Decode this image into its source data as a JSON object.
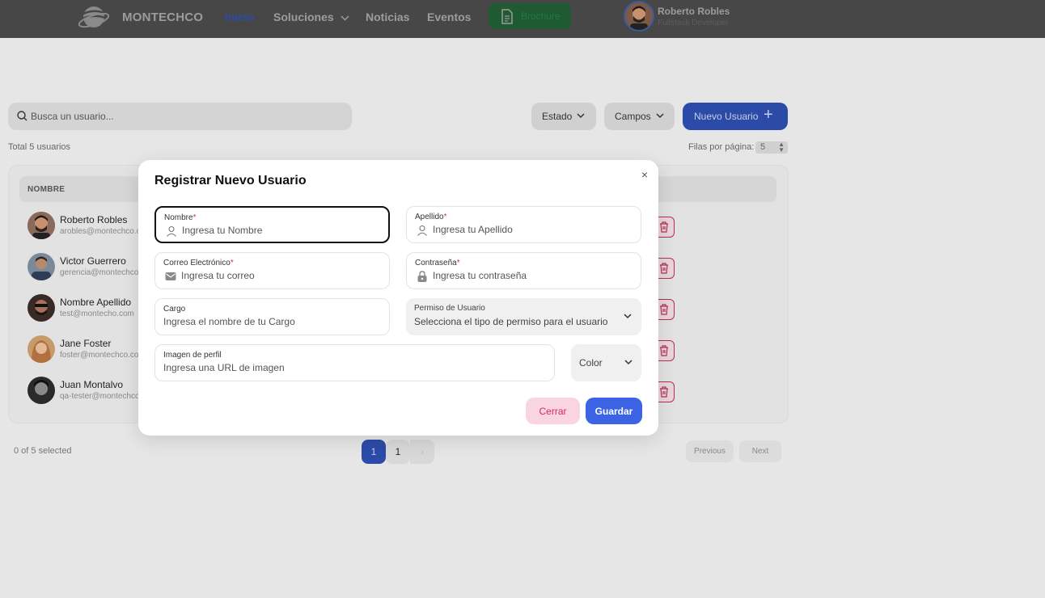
{
  "navbar": {
    "brand": "MONTECHCO",
    "links": {
      "inicio": "Inicio",
      "soluciones": "Soluciones",
      "noticias": "Noticias",
      "eventos": "Eventos"
    },
    "brochure_label": "Brochure",
    "user": {
      "name": "Roberto Robles",
      "role": "Fullstack Developer"
    }
  },
  "toolbar": {
    "search_placeholder": "Busca un usuario...",
    "estado_label": "Estado",
    "campos_label": "Campos",
    "new_user_label": "Nuevo Usuario"
  },
  "table": {
    "total_label": "Total 5 usuarios",
    "rows_per_page_label": "Filas por página:",
    "rows_per_page_value": "5",
    "column_nombre": "NOMBRE",
    "rows": [
      {
        "name": "Roberto Robles",
        "email": "arobles@montechco.co"
      },
      {
        "name": "Victor Guerrero",
        "email": "gerencia@montechco.co"
      },
      {
        "name": "Nombre Apellido",
        "email": "test@montecho.com"
      },
      {
        "name": "Jane Foster",
        "email": "foster@montechco.co"
      },
      {
        "name": "Juan Montalvo",
        "email": "qa-tester@montechco.co"
      }
    ]
  },
  "pagination": {
    "selected_label": "0 of 5 selected",
    "current_page": "1",
    "page_label": "1",
    "next_arrow": "›",
    "previous_label": "Previous",
    "next_label": "Next"
  },
  "modal": {
    "title": "Registrar Nuevo Usuario",
    "close_glyph": "×",
    "fields": {
      "nombre": {
        "label": "Nombre",
        "placeholder": "Ingresa tu Nombre"
      },
      "apellido": {
        "label": "Apellido",
        "placeholder": "Ingresa tu Apellido"
      },
      "correo": {
        "label": "Correo Electrónico",
        "placeholder": "Ingresa tu correo"
      },
      "contrasena": {
        "label": "Contraseña",
        "placeholder": "Ingresa tu contraseña"
      },
      "cargo": {
        "label": "Cargo",
        "placeholder": "Ingresa el nombre de tu Cargo"
      },
      "permiso": {
        "label": "Permiso de Usuario",
        "value": "Selecciona el tipo de permiso para el usuario"
      },
      "imagen": {
        "label": "Imagen de perfil",
        "placeholder": "Ingresa una URL de imagen"
      },
      "color": {
        "value": "Color"
      }
    },
    "required_mark": "*",
    "cerrar_label": "Cerrar",
    "guardar_label": "Guardar"
  },
  "colors": {
    "primary": "#3b63e4",
    "danger": "#e0245e",
    "navbar_bg": "#474747"
  }
}
